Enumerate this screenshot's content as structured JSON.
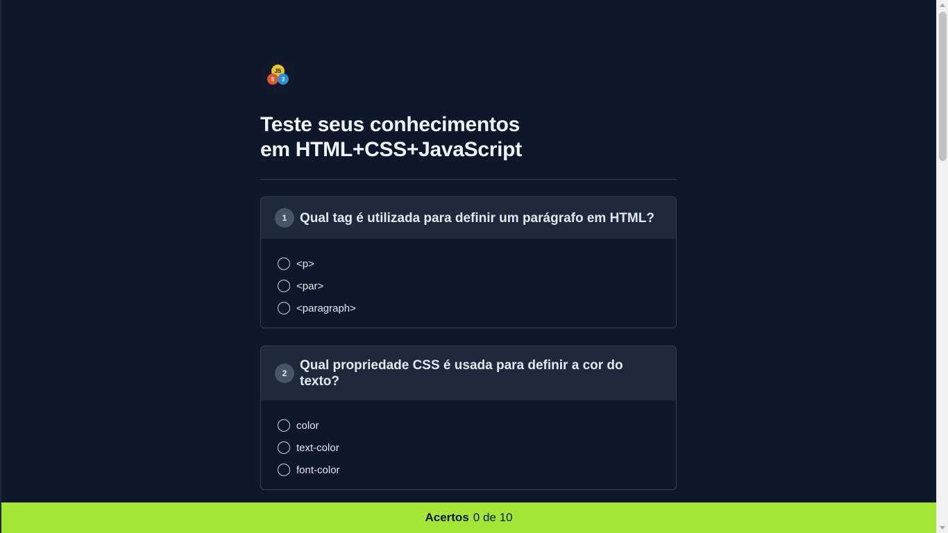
{
  "logo": {
    "js": "JS",
    "html": "5",
    "css": "3"
  },
  "title": {
    "line1": "Teste seus conhecimentos",
    "line2": "em HTML+CSS+JavaScript"
  },
  "questions": [
    {
      "number": "1",
      "text": "Qual tag é utilizada para definir um parágrafo em HTML?",
      "options": [
        "<p>",
        "<par>",
        "<paragraph>"
      ]
    },
    {
      "number": "2",
      "text": "Qual propriedade CSS é usada para definir a cor do texto?",
      "options": [
        "color",
        "text-color",
        "font-color"
      ]
    }
  ],
  "footer": {
    "label": "Acertos",
    "score": "0 de 10"
  },
  "colors": {
    "background": "#0f172a",
    "card_header": "#1e293b",
    "accent": "#a3e635"
  }
}
